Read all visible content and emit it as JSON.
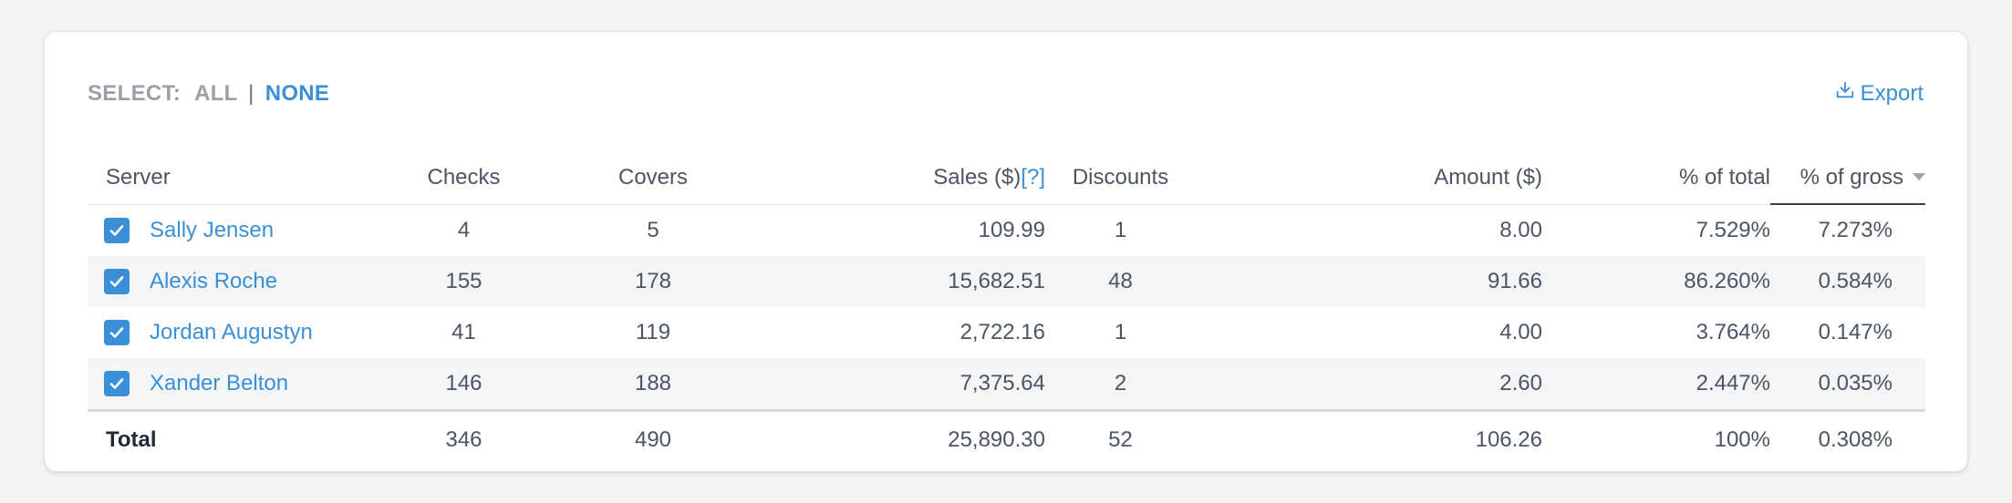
{
  "select": {
    "label": "SELECT:",
    "all": "ALL",
    "separator": "|",
    "none": "NONE"
  },
  "export": {
    "label": "Export",
    "icon": "download-tray-icon"
  },
  "table": {
    "headers": {
      "server": "Server",
      "checks": "Checks",
      "covers": "Covers",
      "sales": "Sales ($)",
      "sales_help": "[?]",
      "discounts": "Discounts",
      "amount": "Amount ($)",
      "pct_total": "% of total",
      "pct_gross": "% of gross"
    },
    "sorted_column": "% of gross",
    "rows": [
      {
        "server": "Sally Jensen",
        "checked": true,
        "checks": "4",
        "covers": "5",
        "sales": "109.99",
        "discounts": "1",
        "amount": "8.00",
        "pct_total": "7.529%",
        "pct_gross": "7.273%"
      },
      {
        "server": "Alexis Roche",
        "checked": true,
        "checks": "155",
        "covers": "178",
        "sales": "15,682.51",
        "discounts": "48",
        "amount": "91.66",
        "pct_total": "86.260%",
        "pct_gross": "0.584%"
      },
      {
        "server": "Jordan Augustyn",
        "checked": true,
        "checks": "41",
        "covers": "119",
        "sales": "2,722.16",
        "discounts": "1",
        "amount": "4.00",
        "pct_total": "3.764%",
        "pct_gross": "0.147%"
      },
      {
        "server": "Xander Belton",
        "checked": true,
        "checks": "146",
        "covers": "188",
        "sales": "7,375.64",
        "discounts": "2",
        "amount": "2.60",
        "pct_total": "2.447%",
        "pct_gross": "0.035%"
      }
    ],
    "total": {
      "label": "Total",
      "checks": "346",
      "covers": "490",
      "sales": "25,890.30",
      "discounts": "52",
      "amount": "106.26",
      "pct_total": "100%",
      "pct_gross": "0.308%"
    }
  },
  "colors": {
    "accent": "#3b8fd6",
    "muted": "#9aa0a8",
    "text": "#4b5563",
    "stripe": "#f3f5f7"
  }
}
